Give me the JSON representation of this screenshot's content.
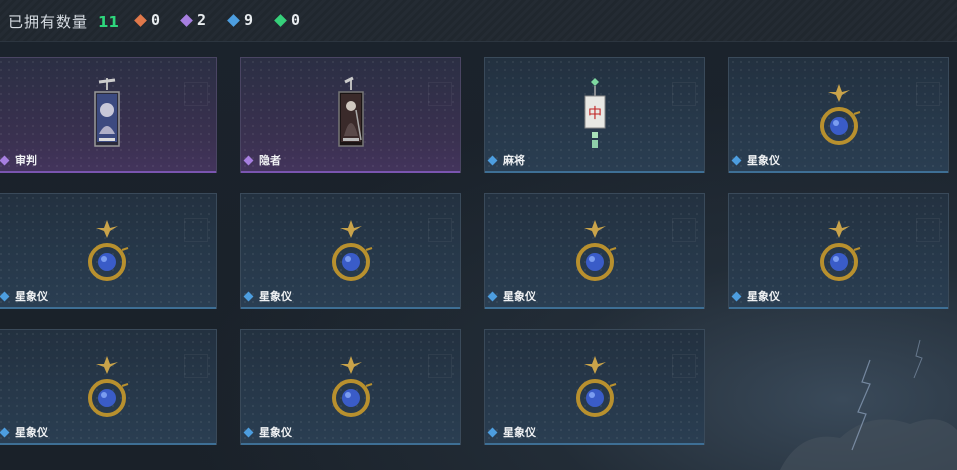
{
  "header": {
    "owned_label": "已拥有数量",
    "owned_count": "11",
    "stats": [
      {
        "icon": "orange-diamond-icon",
        "color": "#e0784a",
        "value": "0"
      },
      {
        "icon": "purple-diamond-icon",
        "color": "#a77fe0",
        "value": "2"
      },
      {
        "icon": "blue-diamond-icon",
        "color": "#4d9ee0",
        "value": "9"
      },
      {
        "icon": "green-diamond-icon",
        "color": "#36d07a",
        "value": "0"
      }
    ]
  },
  "cards": [
    {
      "label": "审判",
      "rarity": "purple",
      "icon": "judgement-tarot-charm-icon"
    },
    {
      "label": "隐者",
      "rarity": "purple",
      "icon": "hermit-tarot-charm-icon"
    },
    {
      "label": "麻将",
      "rarity": "blue",
      "icon": "mahjong-tile-charm-icon"
    },
    {
      "label": "星象仪",
      "rarity": "blue",
      "icon": "astrolabe-charm-icon"
    },
    {
      "label": "星象仪",
      "rarity": "blue",
      "icon": "astrolabe-charm-icon"
    },
    {
      "label": "星象仪",
      "rarity": "blue",
      "icon": "astrolabe-charm-icon"
    },
    {
      "label": "星象仪",
      "rarity": "blue",
      "icon": "astrolabe-charm-icon"
    },
    {
      "label": "星象仪",
      "rarity": "blue",
      "icon": "astrolabe-charm-icon"
    },
    {
      "label": "星象仪",
      "rarity": "blue",
      "icon": "astrolabe-charm-icon"
    },
    {
      "label": "星象仪",
      "rarity": "blue",
      "icon": "astrolabe-charm-icon"
    },
    {
      "label": "星象仪",
      "rarity": "blue",
      "icon": "astrolabe-charm-icon"
    }
  ],
  "rarity_colors": {
    "purple": "#a77fe0",
    "blue": "#4d9ee0"
  }
}
